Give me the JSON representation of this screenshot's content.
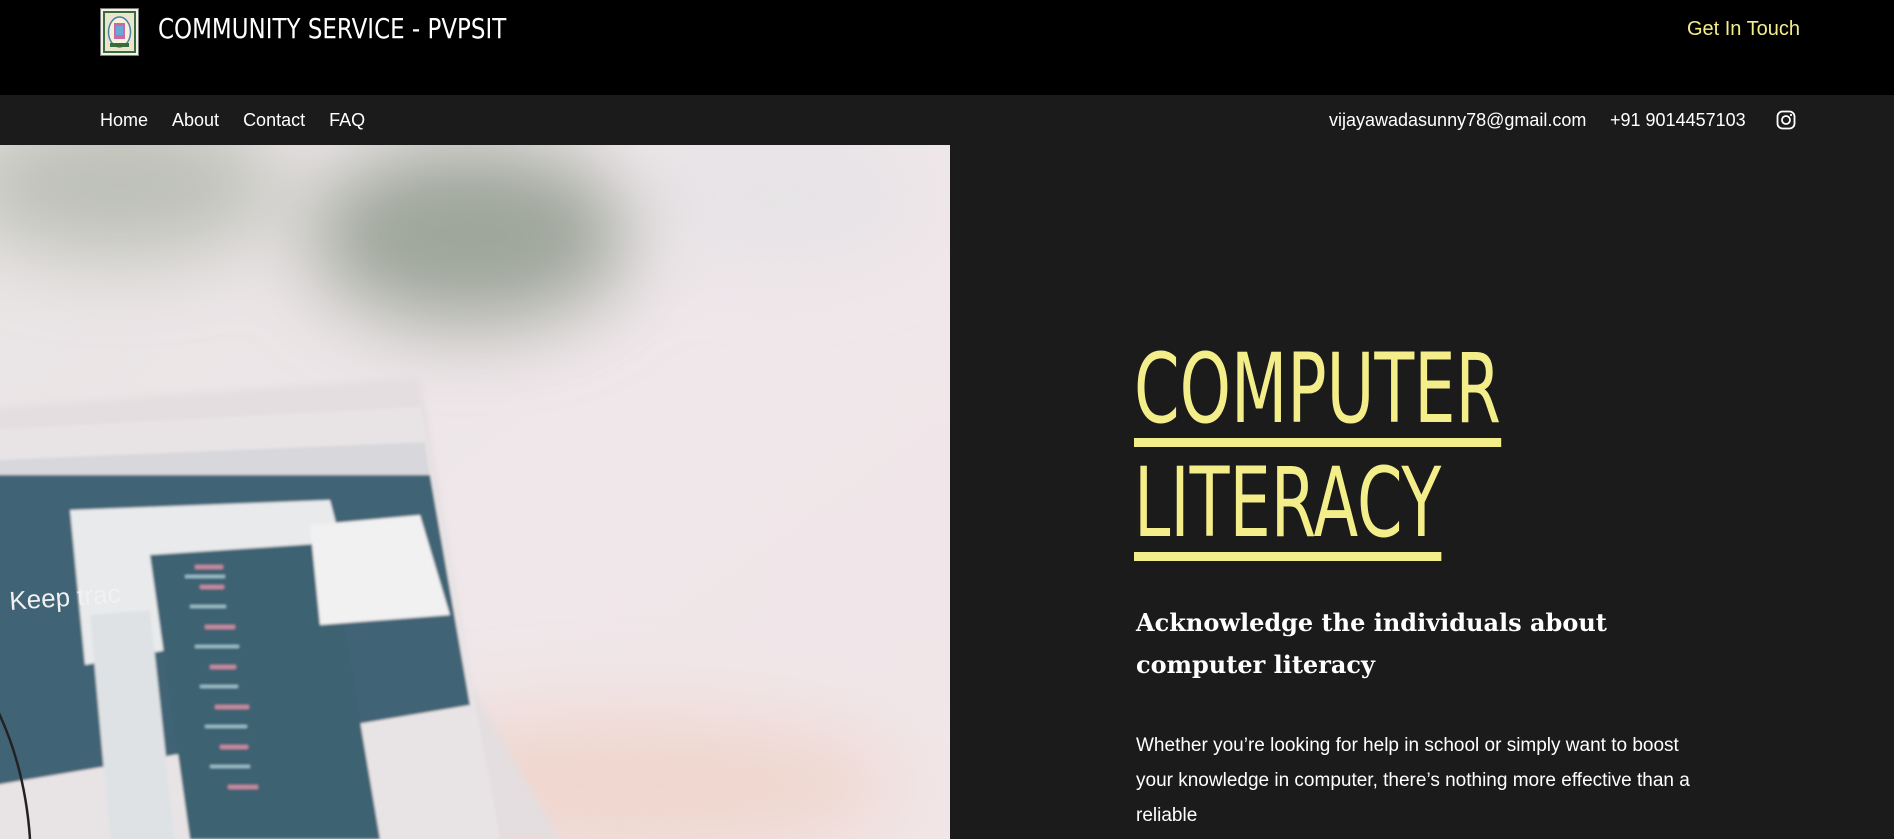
{
  "header": {
    "site_title": "COMMUNITY SERVICE - PVPSIT",
    "cta": "Get In Touch"
  },
  "nav": {
    "items": [
      "Home",
      "About",
      "Contact",
      "FAQ"
    ],
    "email": "vijayawadasunny78@gmail.com",
    "phone": "+91 9014457103"
  },
  "hero": {
    "headline_line1": "COMPUTER",
    "headline_line2": "LITERACY",
    "subheading": "Acknowledge the individuals about computer literacy",
    "body": "Whether you’re looking for help in school or simply want to boost your knowledge in computer, there’s nothing more effective than a reliable",
    "image_text": "Keep trac"
  },
  "colors": {
    "accent": "#f4ee8a",
    "topbar": "#000000",
    "background": "#1b1b1b"
  },
  "icons": {
    "social": "instagram-icon",
    "logo": "college-logo"
  }
}
